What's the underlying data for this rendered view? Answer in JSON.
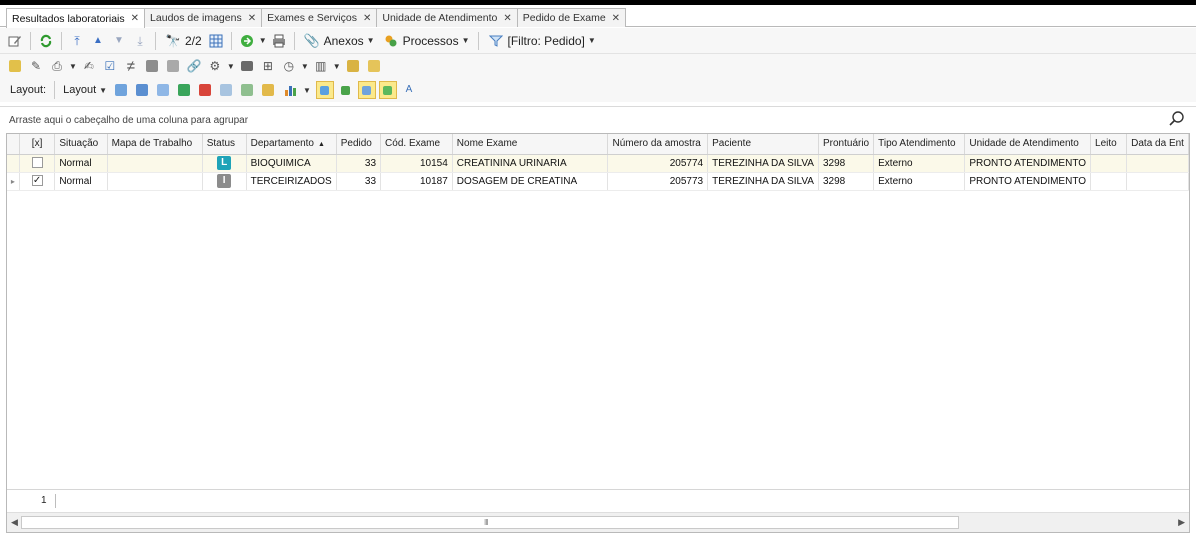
{
  "tabs": [
    {
      "label": "Resultados laboratoriais",
      "close": "✕",
      "active": true
    },
    {
      "label": "Laudos de imagens",
      "close": "✕",
      "active": false
    },
    {
      "label": "Exames e Serviços",
      "close": "✕",
      "active": false
    },
    {
      "label": "Unidade de Atendimento",
      "close": "✕",
      "active": false
    },
    {
      "label": "Pedido de Exame",
      "close": "✕",
      "active": false
    }
  ],
  "toolbar1": {
    "record_counter": "2/2",
    "anexos_label": "Anexos",
    "processos_label": "Processos",
    "filter_label": "[Filtro: Pedido]"
  },
  "toolbar3": {
    "layout_label": "Layout:",
    "layout_menu_label": "Layout"
  },
  "group_panel": {
    "hint": "Arraste aqui o cabeçalho de uma coluna para agrupar"
  },
  "grid": {
    "columns": [
      {
        "label": ""
      },
      {
        "label": "[x]"
      },
      {
        "label": "Situação"
      },
      {
        "label": "Mapa de Trabalho"
      },
      {
        "label": "Status"
      },
      {
        "label": "Departamento",
        "sort": "▲"
      },
      {
        "label": "Pedido"
      },
      {
        "label": "Cód. Exame"
      },
      {
        "label": "Nome Exame"
      },
      {
        "label": "Número da amostra"
      },
      {
        "label": "Paciente"
      },
      {
        "label": "Prontuário"
      },
      {
        "label": "Tipo Atendimento"
      },
      {
        "label": "Unidade de Atendimento"
      },
      {
        "label": "Leito"
      },
      {
        "label": "Data da Ent"
      }
    ],
    "rows": [
      {
        "indicator": "",
        "checked": false,
        "situacao": "Normal",
        "mapa": "",
        "status_letter": "L",
        "status_color": "#1fa3b8",
        "departamento": "BIOQUIMICA",
        "pedido": "33",
        "cod_exame": "10154",
        "nome_exame": "CREATININA URINARIA",
        "numero_amostra": "205774",
        "paciente": "TEREZINHA DA SILVA",
        "prontuario": "3298",
        "tipo_atendimento": "Externo",
        "unidade": "PRONTO ATENDIMENTO",
        "leito": "",
        "data_entrada": ""
      },
      {
        "indicator": "▸",
        "checked": true,
        "situacao": "Normal",
        "mapa": "",
        "status_letter": "I",
        "status_color": "#8c8c8c",
        "departamento": "TERCEIRIZADOS",
        "pedido": "33",
        "cod_exame": "10187",
        "nome_exame": "DOSAGEM DE CREATINA",
        "numero_amostra": "205773",
        "paciente": "TEREZINHA DA SILVA",
        "prontuario": "3298",
        "tipo_atendimento": "Externo",
        "unidade": "PRONTO ATENDIMENTO",
        "leito": "",
        "data_entrada": ""
      }
    ],
    "footer_count": "1",
    "scroll_grip": "III"
  },
  "colors": {
    "selected_row": "#fbf9e9",
    "highlight_button": "#fbe98b"
  }
}
